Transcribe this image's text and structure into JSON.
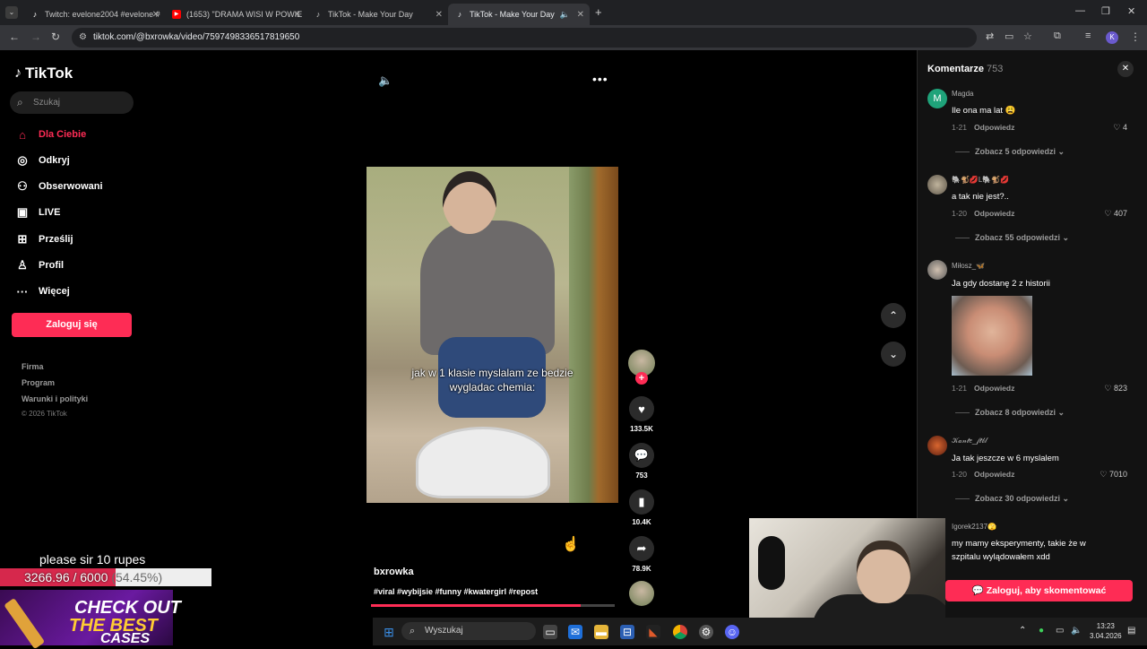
{
  "browser": {
    "tabs": [
      {
        "label": "Twitch: evelone2004 #evelone #",
        "icon": "twitch-icon"
      },
      {
        "label": "(1653) \"DRAMA WISI W POWIE",
        "icon": "youtube-icon"
      },
      {
        "label": "TikTok - Make Your Day",
        "icon": "tiktok-icon"
      },
      {
        "label": "TikTok - Make Your Day",
        "icon": "tiktok-icon",
        "active": true
      }
    ],
    "new_tab": "+",
    "url": "tiktok.com/@bxrowka/video/7597498336517819650",
    "profile_initial": "K"
  },
  "sidebar": {
    "logo": "TikTok",
    "search_placeholder": "Szukaj",
    "nav": [
      {
        "label": "Dla Ciebie",
        "icon": "home-icon",
        "glyph": "⌂",
        "active": true
      },
      {
        "label": "Odkryj",
        "icon": "compass-icon",
        "glyph": "◎"
      },
      {
        "label": "Obserwowani",
        "icon": "following-icon",
        "glyph": "⚇"
      },
      {
        "label": "LIVE",
        "icon": "live-icon",
        "glyph": "▣"
      },
      {
        "label": "Prześlij",
        "icon": "upload-icon",
        "glyph": "⊞"
      },
      {
        "label": "Profil",
        "icon": "profile-icon",
        "glyph": "♙"
      },
      {
        "label": "Więcej",
        "icon": "more-icon",
        "glyph": "···"
      }
    ],
    "login_label": "Zaloguj się",
    "footer_links": [
      "Firma",
      "Program",
      "Warunki i polityki"
    ],
    "copyright": "© 2026 TikTok"
  },
  "video": {
    "caption_line1": "jak w 1 klasie myslalam ze bedzie",
    "caption_line2": "wygladac chemia:",
    "author": "bxrowka",
    "hashtags": "#viral #wybijsie #funny #kwatergirl #repost",
    "progress": 0.86,
    "likes": "133.5K",
    "comments": "753",
    "saves": "10.4K",
    "shares": "78.9K"
  },
  "comments": {
    "title": "Komentarze",
    "count": "753",
    "items": [
      {
        "user": "Magda",
        "avatar_letter": "M",
        "avatar_color": "#1fa37a",
        "text": "Ile ona ma lat 😩",
        "date": "1-21",
        "reply": "Odpowiedz",
        "likes": "4",
        "replies": "Zobacz 5 odpowiedzi"
      },
      {
        "user": "🐘🐒💋L🐘🐒💋",
        "text": "a tak nie jest?..",
        "date": "1-20",
        "reply": "Odpowiedz",
        "likes": "407",
        "replies": "Zobacz 55 odpowiedzi"
      },
      {
        "user": "Miłosz_🦋",
        "text": "Ja gdy dostanę 2 z historii",
        "date": "1-21",
        "reply": "Odpowiedz",
        "likes": "823",
        "replies": "Zobacz 8 odpowiedzi"
      },
      {
        "user": "𝒦𝒶𝓃𝓉𝑒_𝒻𝓉𝒷𝓁",
        "text": "Ja tak jeszcze w 6 myslalem",
        "date": "1-20",
        "reply": "Odpowiedz",
        "likes": "7010",
        "replies": "Zobacz 30 odpowiedzi"
      },
      {
        "user": "Igorek2137🫣",
        "text_line1": "my mamy eksperymenty, takie że w",
        "text_line2": "szpitalu wylądowałem xdd"
      }
    ],
    "login_to_comment": "Zaloguj, aby skomentować"
  },
  "stream_overlay": {
    "donation_text": "please sir 10 rupes",
    "goal_text": "3266.96 / 6000",
    "goal_percent": "(54.45%)",
    "goal_fraction": 0.5445,
    "promo_line1": "CHECK OUT",
    "promo_line2": "THE BEST",
    "promo_line3": "CASES"
  },
  "taskbar": {
    "search_placeholder": "Wyszukaj",
    "time": "13:23",
    "date": "3.04.2026"
  }
}
